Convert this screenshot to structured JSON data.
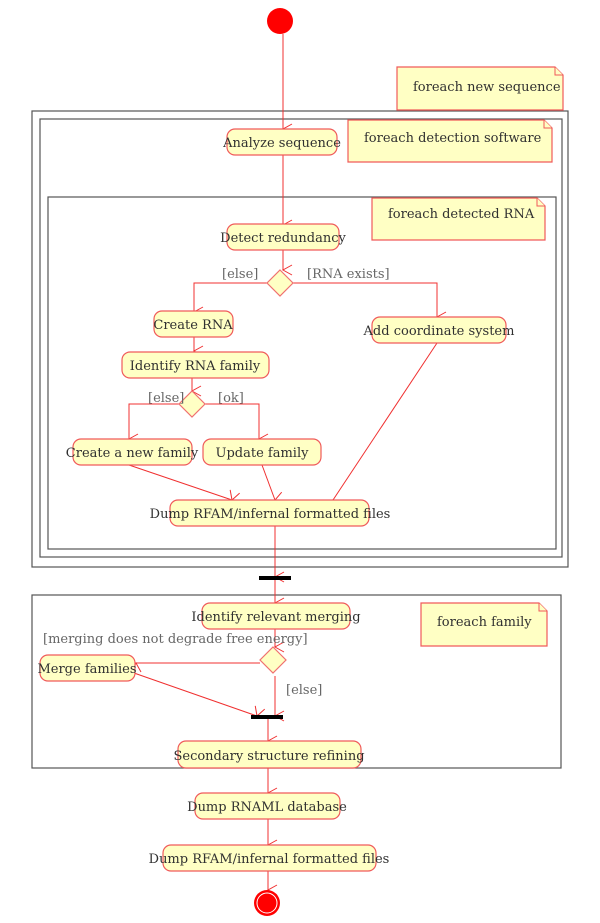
{
  "diagram": {
    "type": "UML activity diagram",
    "colors": {
      "activity_fill": "#ffffc4",
      "activity_border": "#f05a5a",
      "edge": "#f03030",
      "frame": "#555555",
      "node": "#ff0000",
      "guard_text": "#666666"
    },
    "notes": {
      "foreach_new_sequence": "foreach new sequence",
      "foreach_detection_software": "foreach detection software",
      "foreach_detected_rna": "foreach detected RNA",
      "foreach_family": "foreach family"
    },
    "activities": {
      "analyze_sequence": "Analyze sequence",
      "detect_redundancy": "Detect redundancy",
      "create_rna": "Create RNA",
      "add_coordinate_system": "Add coordinate system",
      "identify_rna_family": "Identify RNA family",
      "create_new_family": "Create a new family",
      "update_family": "Update family",
      "dump_rfam_inner": "Dump RFAM/infernal formatted files",
      "identify_relevant_merging": "Identify relevant merging",
      "merge_families": "Merge families",
      "secondary_structure_refining": "Secondary structure refining",
      "dump_rnaml_database": "Dump RNAML database",
      "dump_rfam_final": "Dump RFAM/infernal formatted files"
    },
    "guards": {
      "redundancy_else": "[else]",
      "redundancy_exists": "[RNA exists]",
      "family_else": "[else]",
      "family_ok": "[ok]",
      "merging_condition": "[merging does not degrade free energy]",
      "merging_else": "[else]"
    }
  }
}
